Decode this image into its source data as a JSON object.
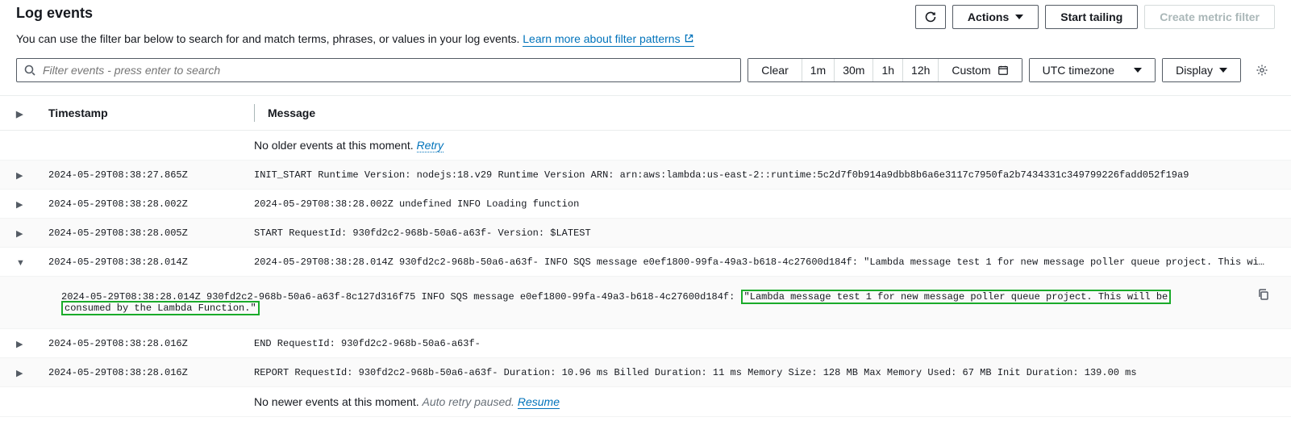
{
  "header": {
    "title": "Log events",
    "refresh_icon": "refresh",
    "actions_label": "Actions",
    "start_tailing_label": "Start tailing",
    "create_filter_label": "Create metric filter"
  },
  "subtitle": {
    "text": "You can use the filter bar below to search for and match terms, phrases, or values in your log events. ",
    "link_text": "Learn more about filter patterns"
  },
  "search": {
    "placeholder": "Filter events - press enter to search"
  },
  "timerange": {
    "clear": "Clear",
    "r1": "1m",
    "r2": "30m",
    "r3": "1h",
    "r4": "12h",
    "custom": "Custom",
    "tz": "UTC timezone",
    "display": "Display"
  },
  "columns": {
    "timestamp": "Timestamp",
    "message": "Message"
  },
  "no_older": {
    "text": "No older events at this moment. ",
    "retry": "Retry"
  },
  "no_newer": {
    "text": "No newer events at this moment. ",
    "auto": "Auto retry paused. ",
    "resume": "Resume"
  },
  "events": [
    {
      "ts": "2024-05-29T08:38:27.865Z",
      "msg": "INIT_START Runtime Version: nodejs:18.v29 Runtime Version ARN: arn:aws:lambda:us-east-2::runtime:5c2d7f0b914a9dbb8b6a6e3117c7950fa2b7434331c349799226fadd052f19a9"
    },
    {
      "ts": "2024-05-29T08:38:28.002Z",
      "msg": "2024-05-29T08:38:28.002Z undefined INFO Loading function"
    },
    {
      "ts": "2024-05-29T08:38:28.005Z",
      "msg": "START RequestId: 930fd2c2-968b-50a6-a63f-            Version: $LATEST"
    },
    {
      "ts": "2024-05-29T08:38:28.014Z",
      "msg": "2024-05-29T08:38:28.014Z 930fd2c2-968b-50a6-a63f-             INFO SQS message e0ef1800-99fa-49a3-b618-4c27600d184f: \"Lambda message test 1 for new message poller queue project. This wi…",
      "expanded": {
        "prefix": "2024-05-29T08:38:28.014Z   930fd2c2-968b-50a6-a63f-8c127d316f75   INFO   SQS message e0ef1800-99fa-49a3-b618-4c27600d184f: ",
        "hilite1": "\"Lambda message test 1 for new message poller queue project. This will be",
        "hilite2": "consumed by the Lambda Function.\""
      }
    },
    {
      "ts": "2024-05-29T08:38:28.016Z",
      "msg": "END RequestId: 930fd2c2-968b-50a6-a63f-"
    },
    {
      "ts": "2024-05-29T08:38:28.016Z",
      "msg": "REPORT RequestId: 930fd2c2-968b-50a6-a63f-              Duration: 10.96 ms Billed Duration: 11 ms Memory Size: 128 MB Max Memory Used: 67 MB Init Duration: 139.00 ms"
    }
  ]
}
